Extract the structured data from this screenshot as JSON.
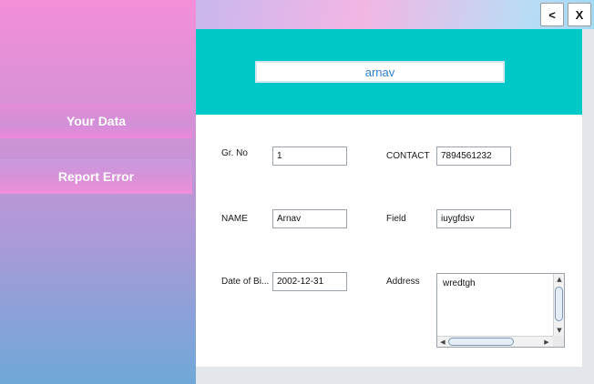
{
  "window": {
    "back_label": "<",
    "close_label": "X"
  },
  "sidebar": {
    "items": [
      {
        "label": "Your Data"
      },
      {
        "label": "Report Error"
      }
    ]
  },
  "header": {
    "name_value": "arnav"
  },
  "form": {
    "gr_no": {
      "label": "Gr. No",
      "value": "1"
    },
    "name": {
      "label": "NAME",
      "value": "Arnav"
    },
    "dob": {
      "label": "Date of Bi...",
      "value": "2002-12-31"
    },
    "contact": {
      "label": "CONTACT",
      "value": "7894561232"
    },
    "field": {
      "label": "Field",
      "value": "iuygfdsv"
    },
    "address": {
      "label": "Address",
      "value": "wredtgh"
    }
  },
  "colors": {
    "header_bg": "#00c9c7",
    "name_text": "#2f7fd0",
    "sidebar_top": "#f48fd8",
    "sidebar_bottom": "#6fa8d8"
  }
}
